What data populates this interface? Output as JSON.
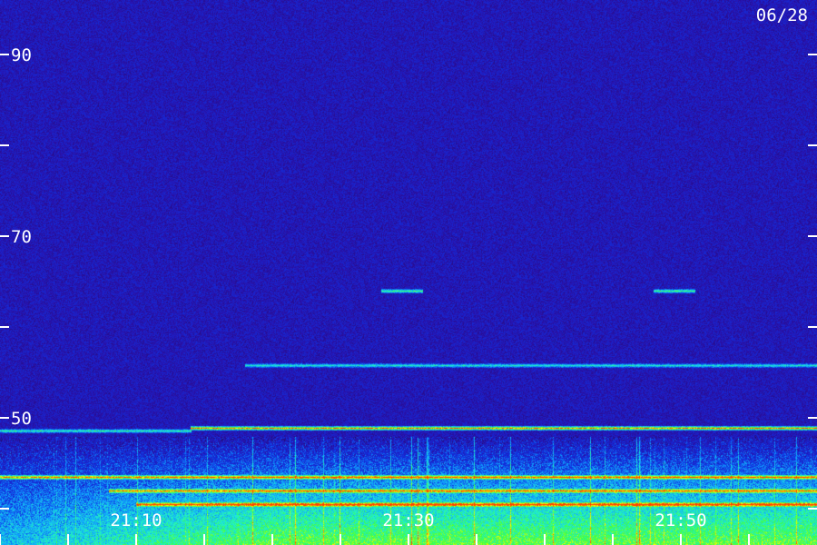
{
  "date_label": "06/28",
  "chart_data": {
    "type": "heatmap",
    "title": "",
    "xlabel": "",
    "ylabel": "",
    "y_tick_labels": [
      "90",
      "70",
      "50"
    ],
    "y_tick_values": [
      90,
      80,
      70,
      60,
      50,
      40
    ],
    "y_labeled_values": [
      90,
      70,
      50
    ],
    "ylim": [
      36,
      96
    ],
    "x_tick_labels": [
      "21:10",
      "21:30",
      "21:50"
    ],
    "x_tick_values_min": [
      0,
      5,
      10,
      15,
      20,
      25,
      30,
      35,
      40,
      45,
      50,
      55
    ],
    "x_labeled_values_min": [
      10,
      30,
      50
    ],
    "xlim_min": [
      0,
      60
    ],
    "x_hour": 21,
    "grid": false,
    "colormap": [
      "#1a0a4a",
      "#2a10a8",
      "#1030e0",
      "#10a0ff",
      "#20f0d0",
      "#40ff40",
      "#ffff00",
      "#ff4000"
    ],
    "background_level": 0.18,
    "bands": [
      {
        "freq": 48.9,
        "time_start": 14,
        "time_end": 60,
        "intensity": 0.82
      },
      {
        "freq": 48.6,
        "time_start": 0,
        "time_end": 14,
        "intensity": 0.45
      },
      {
        "freq": 43.5,
        "time_start": 0,
        "time_end": 60,
        "intensity": 0.7
      },
      {
        "freq": 55.8,
        "time_start": 18,
        "time_end": 60,
        "intensity": 0.4
      },
      {
        "freq": 64.0,
        "time_start": 28,
        "time_end": 31,
        "intensity": 0.5
      },
      {
        "freq": 64.0,
        "time_start": 48,
        "time_end": 51,
        "intensity": 0.5
      },
      {
        "freq": 42.0,
        "time_start": 8,
        "time_end": 60,
        "intensity": 0.6
      },
      {
        "freq": 40.5,
        "time_start": 10,
        "time_end": 60,
        "intensity": 0.65
      }
    ],
    "broadband_floor": {
      "freq_top": 48,
      "intensity": 0.55
    }
  }
}
